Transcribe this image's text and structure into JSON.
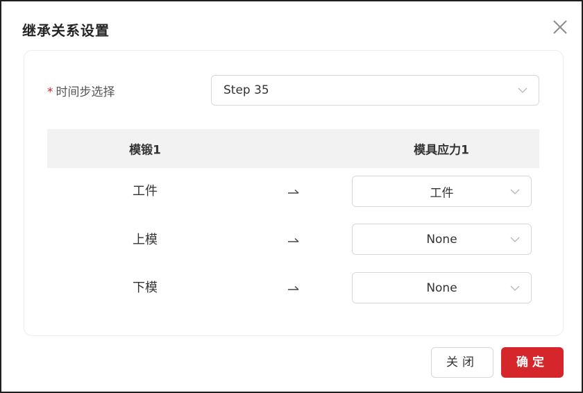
{
  "dialog": {
    "title": "继承关系设置",
    "close_icon": "close-icon"
  },
  "form": {
    "required_mark": "*",
    "time_step_label": "时间步选择",
    "time_step_value": "Step 35"
  },
  "table": {
    "headers": [
      "模锻1",
      "模具应力1"
    ],
    "rows": [
      {
        "source": "工件",
        "arrow_icon": "right-harpoon-icon",
        "target": "工件"
      },
      {
        "source": "上模",
        "arrow_icon": "right-harpoon-icon",
        "target": "None"
      },
      {
        "source": "下模",
        "arrow_icon": "right-harpoon-icon",
        "target": "None"
      }
    ]
  },
  "footer": {
    "close_label": "关闭",
    "confirm_label": "确定"
  },
  "colors": {
    "accent": "#d4262b",
    "header_bg": "#f2f2f2",
    "border": "#d7d7d7"
  }
}
